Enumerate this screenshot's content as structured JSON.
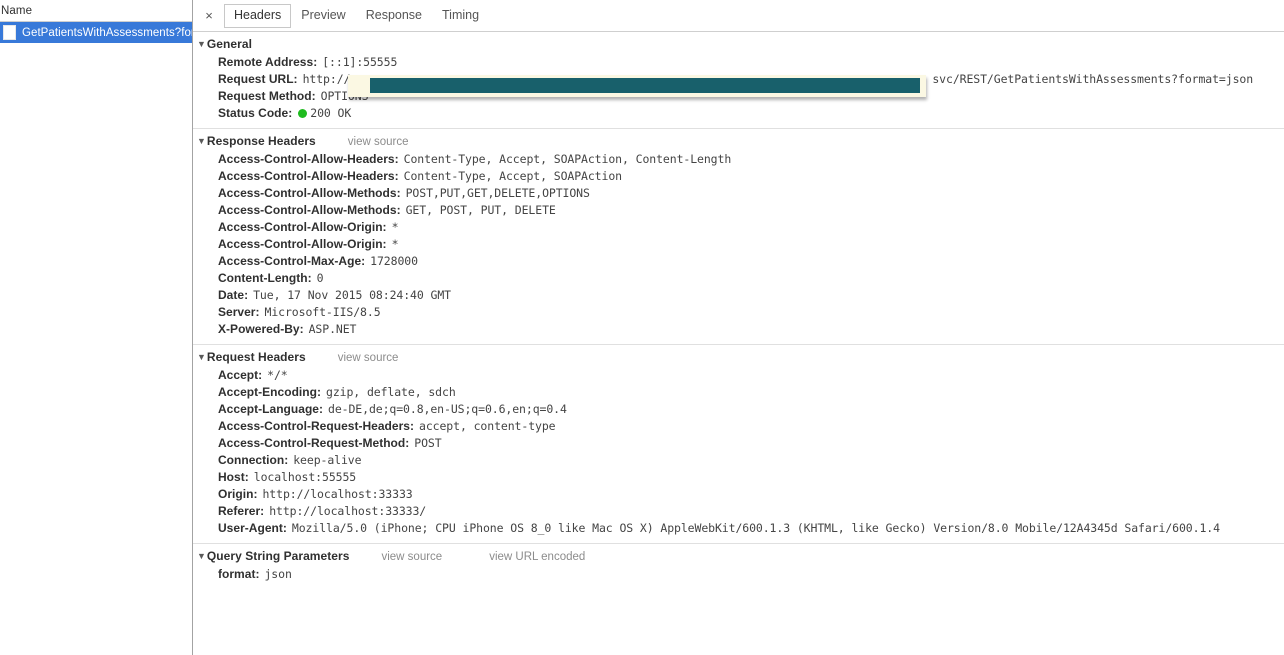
{
  "left_panel": {
    "column_header": "Name",
    "requests": [
      {
        "name": "GetPatientsWithAssessments?for...",
        "icon": "document-icon",
        "selected": true
      }
    ],
    "selected_color": "#3879d9"
  },
  "tabbar": {
    "close_label": "×",
    "tabs": [
      {
        "label": "Headers",
        "active": true
      },
      {
        "label": "Preview",
        "active": false
      },
      {
        "label": "Response",
        "active": false
      },
      {
        "label": "Timing",
        "active": false
      }
    ]
  },
  "sections": {
    "general": {
      "title": "General",
      "disclosure": "▼",
      "rows": {
        "remote_address_key": "Remote Address:",
        "remote_address_val": "[::1]:55555",
        "request_url_key": "Request URL:",
        "request_url_prefix": "http://",
        "request_url_redacted": true,
        "request_url_suffix": "svc/REST/GetPatientsWithAssessments?format=json",
        "request_method_key": "Request Method:",
        "request_method_val": "OPTIONS",
        "status_code_key": "Status Code:",
        "status_code_val": "200 OK",
        "status_color": "#1fbb1f"
      }
    },
    "response_headers": {
      "title": "Response Headers",
      "disclosure": "▼",
      "view_source": "view source",
      "items": [
        {
          "key": "Access-Control-Allow-Headers:",
          "value": "Content-Type, Accept, SOAPAction, Content-Length"
        },
        {
          "key": "Access-Control-Allow-Headers:",
          "value": "Content-Type, Accept, SOAPAction"
        },
        {
          "key": "Access-Control-Allow-Methods:",
          "value": "POST,PUT,GET,DELETE,OPTIONS"
        },
        {
          "key": "Access-Control-Allow-Methods:",
          "value": "GET, POST, PUT, DELETE"
        },
        {
          "key": "Access-Control-Allow-Origin:",
          "value": "*"
        },
        {
          "key": "Access-Control-Allow-Origin:",
          "value": "*"
        },
        {
          "key": "Access-Control-Max-Age:",
          "value": "1728000"
        },
        {
          "key": "Content-Length:",
          "value": "0"
        },
        {
          "key": "Date:",
          "value": "Tue, 17 Nov 2015 08:24:40 GMT"
        },
        {
          "key": "Server:",
          "value": "Microsoft-IIS/8.5"
        },
        {
          "key": "X-Powered-By:",
          "value": "ASP.NET"
        }
      ]
    },
    "request_headers": {
      "title": "Request Headers",
      "disclosure": "▼",
      "view_source": "view source",
      "items": [
        {
          "key": "Accept:",
          "value": "*/*"
        },
        {
          "key": "Accept-Encoding:",
          "value": "gzip, deflate, sdch"
        },
        {
          "key": "Accept-Language:",
          "value": "de-DE,de;q=0.8,en-US;q=0.6,en;q=0.4"
        },
        {
          "key": "Access-Control-Request-Headers:",
          "value": "accept, content-type"
        },
        {
          "key": "Access-Control-Request-Method:",
          "value": "POST"
        },
        {
          "key": "Connection:",
          "value": "keep-alive"
        },
        {
          "key": "Host:",
          "value": "localhost:55555"
        },
        {
          "key": "Origin:",
          "value": "http://localhost:33333"
        },
        {
          "key": "Referer:",
          "value": "http://localhost:33333/"
        },
        {
          "key": "User-Agent:",
          "value": "Mozilla/5.0 (iPhone; CPU iPhone OS 8_0 like Mac OS X) AppleWebKit/600.1.3 (KHTML, like Gecko) Version/8.0 Mobile/12A4345d Safari/600.1.4"
        }
      ]
    },
    "query_string_parameters": {
      "title": "Query String Parameters",
      "disclosure": "▼",
      "view_source": "view source",
      "view_url_encoded": "view URL encoded",
      "items": [
        {
          "key": "format:",
          "value": "json"
        }
      ]
    }
  }
}
